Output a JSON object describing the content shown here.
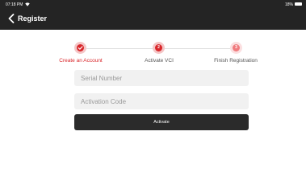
{
  "statusbar": {
    "time": "07:18 PM",
    "battery": "18%"
  },
  "header": {
    "title": "Register"
  },
  "steps": [
    {
      "label": "Create an Account",
      "number": "",
      "state": "completed"
    },
    {
      "label": "Activate VCI",
      "number": "2",
      "state": "current"
    },
    {
      "label": "Finish Registration",
      "number": "3",
      "state": "pending"
    }
  ],
  "form": {
    "serial_number_placeholder": "Serial Number",
    "activation_code_placeholder": "Activation Code",
    "activate_label": "Activate"
  },
  "colors": {
    "appbar": "#242424",
    "step_completed": "#d9272b",
    "step_current": "#d9272b",
    "step_pending": "#f07b7e",
    "button": "#2b2b2b"
  }
}
